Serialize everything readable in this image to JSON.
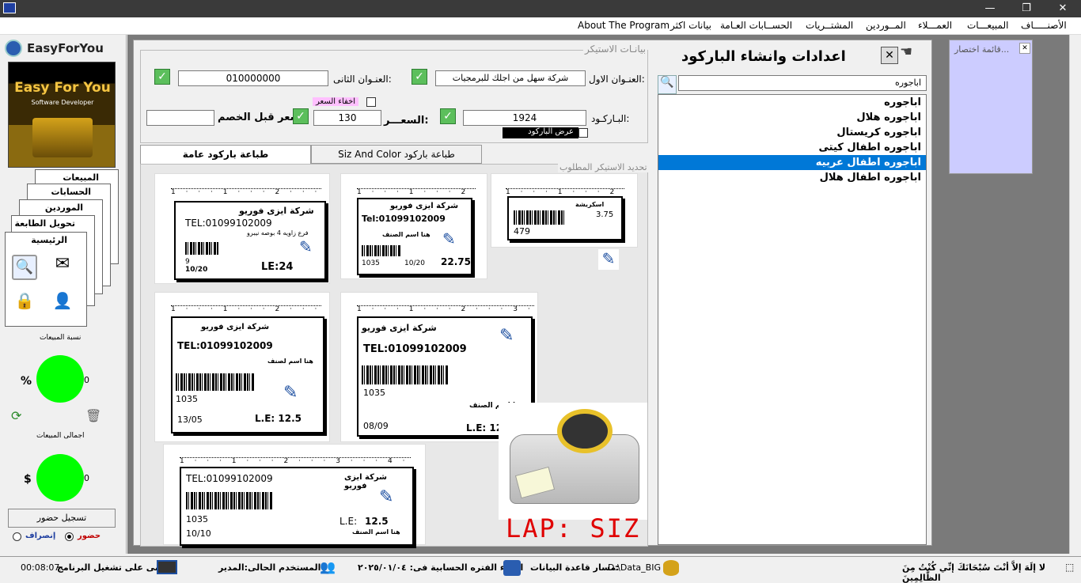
{
  "menu": [
    "الأصنـــــاف",
    "المبيعـــات",
    "العمـــلاء",
    "المــوردين",
    "المشتــريات",
    "الحســابات العـامة",
    "بيانات اكثر",
    "About The Program"
  ],
  "sidebar": {
    "brand": "EasyForYou",
    "logo_text": "Easy For You",
    "logo_sub": "Software Developer",
    "tabs": [
      "المبيعات",
      "الحسابات",
      "الموردين",
      "تحويل الطابعة",
      "الرئيسية"
    ],
    "sales_ratio_label": "نسبة المبيعات",
    "percent_symbol": "%",
    "ratio_value": "0",
    "total_sales_label": "اجمالى المبيعات",
    "currency_symbol": "$",
    "total_value": "0",
    "attendance_button": "تسجيل حضور",
    "presence_label": "حضور",
    "departure_label": "إنصراف"
  },
  "window": {
    "title": "اعدادات وانشاء الباركود",
    "close": "✕"
  },
  "shortcut_list": {
    "title": "قائمة اختصار..."
  },
  "sticker_data": {
    "group_title": "بيانـات الاستيكر",
    "address1_label": "العنـوان الاول:",
    "address1_value": "شركة سهل من اجلك للبرمجيات",
    "address2_label": "العنـوان الثانى:",
    "address2_value": "010000000",
    "barcode_label": "البـاركـود:",
    "barcode_value": "1924",
    "price_label": "السعـــر:",
    "price_value": "130",
    "old_price_label": "سعر قبل الخصم",
    "old_price_value": "",
    "hide_price": "اخفاء السعر",
    "show_barcode": "عرض الباركود"
  },
  "tabs": [
    "طباعة باركود عامة",
    "Siz And Color طباعة باركود"
  ],
  "select_label": "تحديد الاستيكر المطلوب",
  "search": {
    "value": "اباجوره"
  },
  "products": [
    "اباجوره",
    "اباجوره هلال",
    "اباجوره كريستال",
    "اباجوره اطفال كيتى",
    "اباجوره اطفال عربيه",
    "اباجوره اطفال هلال"
  ],
  "selected_index": 4,
  "stickers": {
    "s1": {
      "ruler": "1 · · · 1 · · · 2 · · · 3 · · · 4 · ·",
      "company": "شركة ايزى فوريو",
      "tel": "TEL:01099102009",
      "product": "فرع زاويه 4 بوصه نيبرو",
      "code": "9",
      "date": "10/20",
      "price": "LE:24"
    },
    "s2": {
      "ruler": "1 · · · 1 · · · 2 · · · 3 ·",
      "company": "شركة ايزى فوريو",
      "tel": "Tel:01099102009",
      "product": "هنا اسم الصنف",
      "code": "1035",
      "date": "10/20",
      "price": "22.75"
    },
    "s3": {
      "ruler": "1 · · · 1 · · · 2 · · · 3",
      "product": "اسكريشة",
      "price": "3.75",
      "code": "479"
    },
    "s4": {
      "ruler": "1 · · · 1 · · · 2 · · · 3 · · · 4 ·",
      "company": "شركة ايزى فوريو",
      "tel": "TEL:01099102009",
      "product": "هنا اسم لصنف",
      "code": "1035",
      "date": "13/05",
      "price": "L.E: 12.5"
    },
    "s5": {
      "ruler": "1 · · · 1 · · · 2 · · · 3 · · · 4 · · · 5 ·",
      "company": "شركة ايزى فوريو",
      "tel": "TEL:01099102009",
      "product": "هنا اسم الصنف",
      "code": "1035",
      "date": "08/09",
      "price": "L.E: 12.5"
    },
    "s6": {
      "ruler": "1 · · · 1 · · · 2 · · · 3 · · · 4 · · · 5 · · · 6 · · · 7 ·",
      "company": "شركة ايزى فوريو",
      "tel": "TEL:01099102009",
      "product": "هنا اسم الصنف",
      "code": "1035",
      "date": "10/10",
      "price_label": "L.E:",
      "price": "12.5"
    }
  },
  "printer_caption": "LAP: SIZ",
  "status": {
    "runtime_label": "مضى على تشغيل البرنامج",
    "runtime": "00:08:07",
    "user": "المستخدم الحالى:المدير",
    "period": "انتهاء الفتره الحسابية فى: ٢٠٢٥/٠١/٠٤",
    "db_path_label": "مسار قاعدة البيانات:",
    "db_path": "D:\\Data_BIG",
    "verse": "لا إلَهَ إلاَّ أنْتَ سُبْحَانَكَ إنِّي كُنْتُ مِنَ الظَّالِمِينَ"
  },
  "colors": {
    "selection": "#0078d7",
    "gauge": "#00ff00",
    "printer_caption": "#e00000"
  }
}
